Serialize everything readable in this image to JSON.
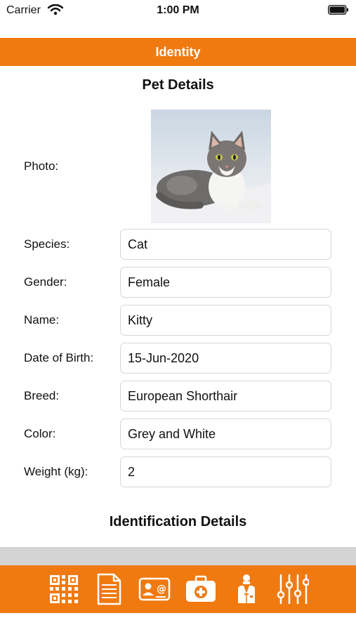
{
  "status_bar": {
    "carrier": "Carrier",
    "time": "1:00 PM"
  },
  "header": {
    "title": "Identity"
  },
  "pet_details": {
    "title": "Pet Details",
    "photo_label": "Photo:",
    "fields": [
      {
        "label": "Species:",
        "value": "Cat"
      },
      {
        "label": "Gender:",
        "value": "Female"
      },
      {
        "label": "Name:",
        "value": "Kitty"
      },
      {
        "label": "Date of Birth:",
        "value": "15-Jun-2020"
      },
      {
        "label": "Breed:",
        "value": "European Shorthair"
      },
      {
        "label": "Color:",
        "value": "Grey and White"
      },
      {
        "label": "Weight (kg):",
        "value": "2"
      }
    ]
  },
  "identification_details": {
    "title": "Identification Details"
  },
  "tab_bar": {
    "icons": [
      "qr-code-icon",
      "document-icon",
      "contact-card-icon",
      "medical-kit-icon",
      "veterinarian-icon",
      "settings-sliders-icon"
    ]
  },
  "colors": {
    "accent": "#F07A10",
    "band": "#D4D4D4",
    "field_border": "#D6D6D6"
  }
}
